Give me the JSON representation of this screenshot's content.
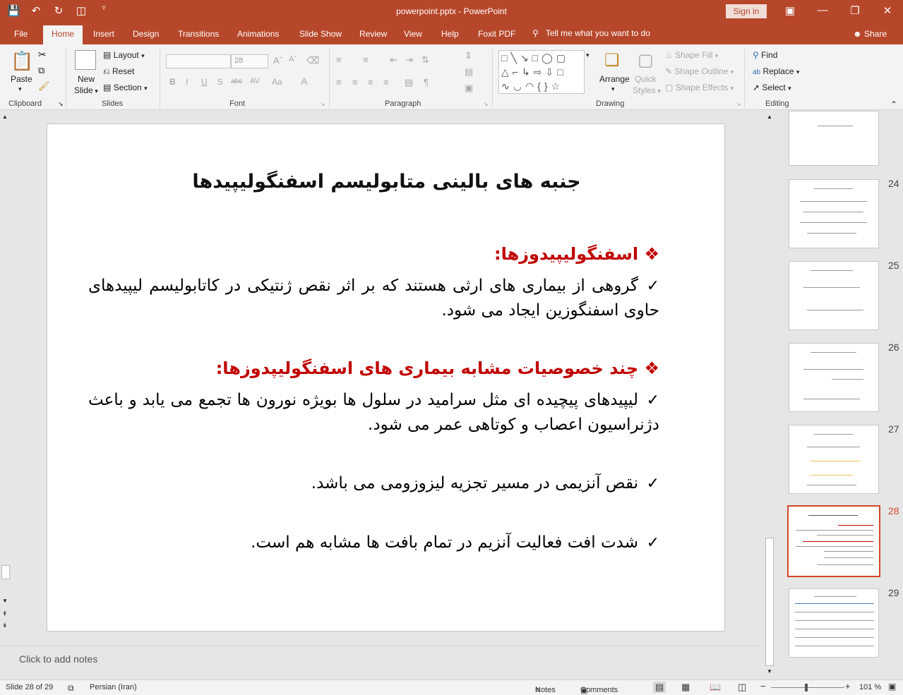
{
  "titlebar": {
    "doc_title": "powerpoint.pptx  -  PowerPoint",
    "signin": "Sign in",
    "qat_icons": [
      "save-icon",
      "undo-icon",
      "redo-icon",
      "present-icon",
      "customize-icon"
    ]
  },
  "tabs": [
    "File",
    "Home",
    "Insert",
    "Design",
    "Transitions",
    "Animations",
    "Slide Show",
    "Review",
    "View",
    "Help",
    "Foxit PDF"
  ],
  "tell_me": "Tell me what you want to do",
  "share": "Share",
  "ribbon": {
    "clipboard": {
      "paste": "Paste",
      "label": "Clipboard"
    },
    "slides": {
      "new_slide_1": "New",
      "new_slide_2": "Slide",
      "layout": "Layout",
      "reset": "Reset",
      "section": "Section",
      "label": "Slides"
    },
    "font": {
      "font_name": "",
      "font_size": "28",
      "label": "Font"
    },
    "paragraph": {
      "label": "Paragraph"
    },
    "drawing": {
      "arrange": "Arrange",
      "quick_styles_1": "Quick",
      "quick_styles_2": "Styles",
      "shape_fill": "Shape Fill",
      "shape_outline": "Shape Outline",
      "shape_effects": "Shape Effects",
      "label": "Drawing"
    },
    "editing": {
      "find": "Find",
      "replace": "Replace",
      "select": "Select",
      "label": "Editing"
    }
  },
  "slide": {
    "title": "جنبه های بالینی متابولیسم اسفنگولیپیدها",
    "heading1": "اسفنگولیپیدوزها:",
    "item1": "گروهی از بیماری های ارثی هستند که بر اثر نقص ژنتیکی در کاتابولیسم لیپیدهای حاوی اسفنگوزین ایجاد می شود.",
    "heading2": "چند خصوصیات مشابه بیماری های اسفنگولیپدوزها:",
    "item2": "لیپیدهای پیچیده ای مثل سرامید در سلول ها بویژه نورون ها تجمع می یابد و باعث دژنراسیون اعصاب و کوتاهی عمر می شود.",
    "item3": "نقص آنزیمی در مسیر تجزیه لیزوزومی می باشد.",
    "item4": "شدت افت فعالیت آنزیم در تمام بافت ها مشابه هم است.",
    "bullet_diamond": "❖",
    "bullet_check": "✓"
  },
  "thumbnails": {
    "numbers": [
      "24",
      "25",
      "26",
      "27",
      "28",
      "29"
    ],
    "selected": "28"
  },
  "notes_placeholder": "Click to add notes",
  "status": {
    "slide_info": "Slide 28 of 29",
    "language": "Persian (Iran)",
    "notes": "Notes",
    "comments": "Comments",
    "zoom": "101 %"
  }
}
